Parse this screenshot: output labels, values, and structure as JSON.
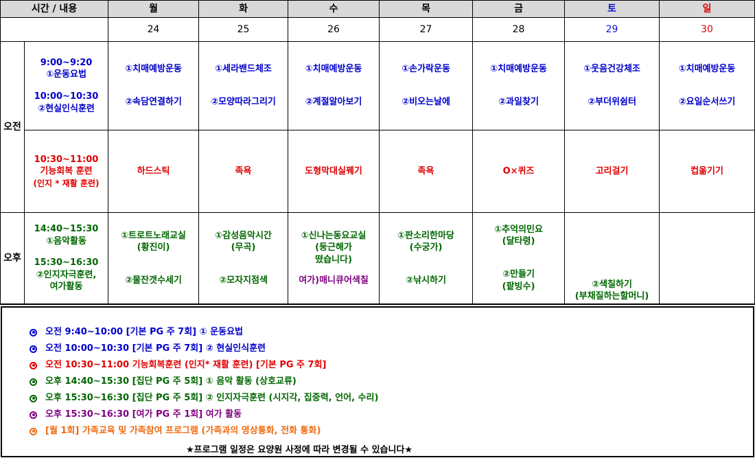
{
  "header": {
    "time_col": "시간 / 내용",
    "days": [
      "월",
      "화",
      "수",
      "목",
      "금",
      "토",
      "일"
    ]
  },
  "dates": [
    "24",
    "25",
    "26",
    "27",
    "28",
    "29",
    "30"
  ],
  "periods": {
    "am": "오전",
    "pm": "오후"
  },
  "am_block1": {
    "time1": "9:00~9:20",
    "label1": "①운동요법",
    "time2": "10:00~10:30",
    "label2": "②현실인식훈련",
    "cells": [
      {
        "top": "①치매예방운동",
        "bottom": "②속담연결하기"
      },
      {
        "top": "①세라밴드체조",
        "bottom": "②모양따라그리기"
      },
      {
        "top": "①치매예방운동",
        "bottom": "②계절알아보기"
      },
      {
        "top": "①손가락운동",
        "bottom": "②비오는날에"
      },
      {
        "top": "①치매예방운동",
        "bottom": "②과일찾기"
      },
      {
        "top": "①웃음건강체조",
        "bottom": "②부더위쉼터"
      },
      {
        "top": "①치매예방운동",
        "bottom": "②요일순서쓰기"
      }
    ]
  },
  "am_block2": {
    "time": "10:30~11:00",
    "label": "기능회복 훈련",
    "sub": "(인지 * 재활 훈련)",
    "cells": [
      "하드스틱",
      "족욕",
      "도형막대실꿰기",
      "족욕",
      "O×퀴즈",
      "고리걸기",
      "컵옮기기"
    ]
  },
  "pm_block": {
    "time1": "14:40~15:30",
    "label1": "①음악활동",
    "time2": "15:30~16:30",
    "label2a": "②인지자극훈련,",
    "label2b": "여가활동",
    "cells": [
      {
        "top": [
          "①트로트노래교실",
          "(황진이)"
        ],
        "bottom": [
          "②물잔갯수세기"
        ]
      },
      {
        "top": [
          "①감성음악시간",
          "(무곡)"
        ],
        "bottom": [
          "②모자지점색"
        ]
      },
      {
        "top": [
          "①신나는동요교실",
          "(둥근해가",
          "떴습니다)"
        ],
        "bottom": [
          "여가)매니큐어색칠"
        ]
      },
      {
        "top": [
          "①판소리한마당",
          "(수궁가)"
        ],
        "bottom": [
          "②낚시하기"
        ]
      },
      {
        "top": [
          "①추억의민요",
          "(달타령)"
        ],
        "bottom": [
          "②만들기",
          "(팥빙수)"
        ]
      },
      {
        "top": [],
        "bottom": [
          "②색칠하기",
          "(부채질하는할머니)"
        ]
      },
      {
        "top": [],
        "bottom": []
      }
    ]
  },
  "notes": [
    "오전 9:40~10:00 [기본 PG 주 7회] ① 운동요법",
    "오전 10:00~10:30 [기본 PG 주 7회] ② 현실인식훈련",
    "오전 10:30~11:00 기능회복훈련 (인지* 재활 훈련) [기본 PG 주 7회]",
    "오후 14:40~15:30 [집단 PG 주 5회] ① 음악 활동 (상호교류)",
    "오후 15:30~16:30 [집단 PG 주 5회] ② 인지자극훈련 (시지각, 집중력, 언어, 수리)",
    "오후 15:30~16:30 [여가 PG 주 1회]  여가 활동",
    "[월 1회] 가족교육 및 가족참여 프로그램 (가족과의 영상통화, 전화 통화)"
  ],
  "notice": "★프로그램 일정은 요양원 사정에 따라 변경될 수 있습니다★",
  "colors": {
    "blue": "#0000cc",
    "green": "#006600",
    "red": "#e00000",
    "purple": "#800080",
    "orange": "#ee6a10",
    "header_bg": "#d9d9d9"
  }
}
